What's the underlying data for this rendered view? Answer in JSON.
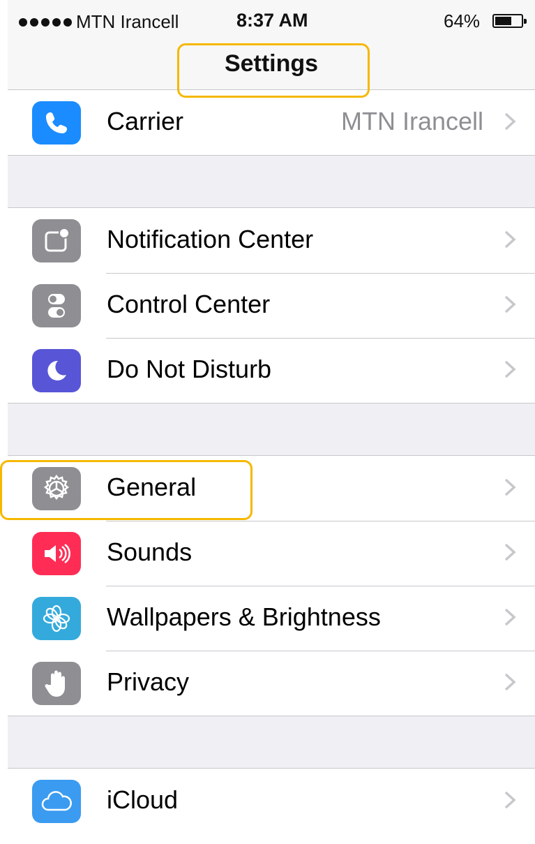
{
  "status_bar": {
    "signal_dots": 5,
    "carrier": "MTN Irancell",
    "time": "8:37 AM",
    "battery_percent": "64%",
    "battery_level": 0.64
  },
  "nav": {
    "title": "Settings"
  },
  "groups": [
    {
      "rows": [
        {
          "label": "Carrier",
          "detail": "MTN Irancell",
          "icon": "phone-icon",
          "color": "#1a8cff"
        }
      ]
    },
    {
      "rows": [
        {
          "label": "Notification Center",
          "icon": "notification-icon",
          "color": "#8e8e93"
        },
        {
          "label": "Control Center",
          "icon": "toggles-icon",
          "color": "#8e8e93"
        },
        {
          "label": "Do Not Disturb",
          "icon": "moon-icon",
          "color": "#5856d6"
        }
      ]
    },
    {
      "rows": [
        {
          "label": "General",
          "icon": "gear-icon",
          "color": "#8e8e93"
        },
        {
          "label": "Sounds",
          "icon": "speaker-icon",
          "color": "#ff2d55"
        },
        {
          "label": "Wallpapers & Brightness",
          "icon": "flower-icon",
          "color": "#34aadc"
        },
        {
          "label": "Privacy",
          "icon": "hand-icon",
          "color": "#8e8e93"
        }
      ]
    },
    {
      "rows": [
        {
          "label": "iCloud",
          "icon": "cloud-icon",
          "color": "#3b9bf0"
        }
      ]
    }
  ],
  "highlights": [
    "Settings",
    "General"
  ],
  "accent_color": "#f5b800"
}
